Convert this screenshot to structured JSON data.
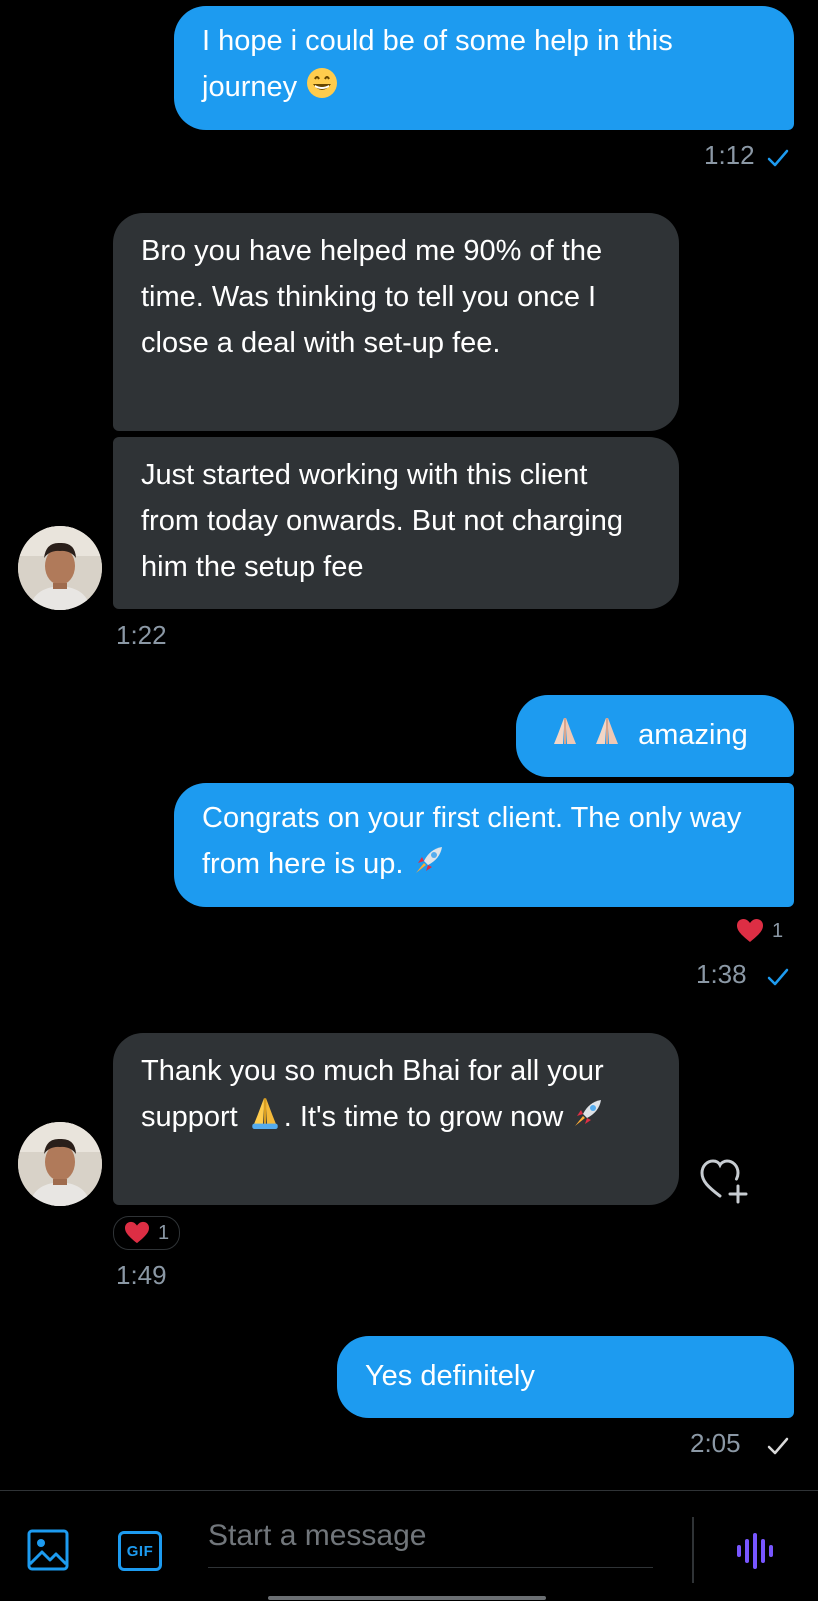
{
  "colors": {
    "accent": "#1d9bf0",
    "received_bubble": "#2f3336",
    "background": "#000000",
    "timestamp": "#8b98a5",
    "heart": "#f91880"
  },
  "messages": [
    {
      "direction": "sent",
      "text": "I hope i could be of some help in this journey",
      "trailing_emoji": "grinning-face-emoji",
      "time": "1:12",
      "status": "read"
    },
    {
      "direction": "received",
      "text": "Bro you have helped me 90% of the time. Was thinking to tell you once I close a deal with set-up fee."
    },
    {
      "direction": "received",
      "text": "Just started working with this client from today onwards. But not charging him the setup fee",
      "time": "1:22"
    },
    {
      "direction": "sent",
      "text": "amazing",
      "leading_emojis": [
        "folded-hands-emoji",
        "folded-hands-emoji"
      ]
    },
    {
      "direction": "sent",
      "text": "Congrats on your first client. The only way from here is up.",
      "trailing_emoji": "rocket-emoji",
      "reaction": {
        "icon": "heart-icon",
        "count": "1"
      },
      "time": "1:38",
      "status": "read"
    },
    {
      "direction": "received",
      "text_part_1": "Thank you so much Bhai for all your support",
      "text_part_2": ". It's time to grow now",
      "reaction": {
        "icon": "heart-icon",
        "count": "1"
      },
      "time": "1:49"
    },
    {
      "direction": "sent",
      "text": "Yes definitely",
      "time": "2:05",
      "status": "sent"
    }
  ],
  "composer": {
    "placeholder": "Start a message",
    "media_icon": "image-icon",
    "gif_label": "GIF",
    "voice_icon": "voice-waveform-icon"
  }
}
